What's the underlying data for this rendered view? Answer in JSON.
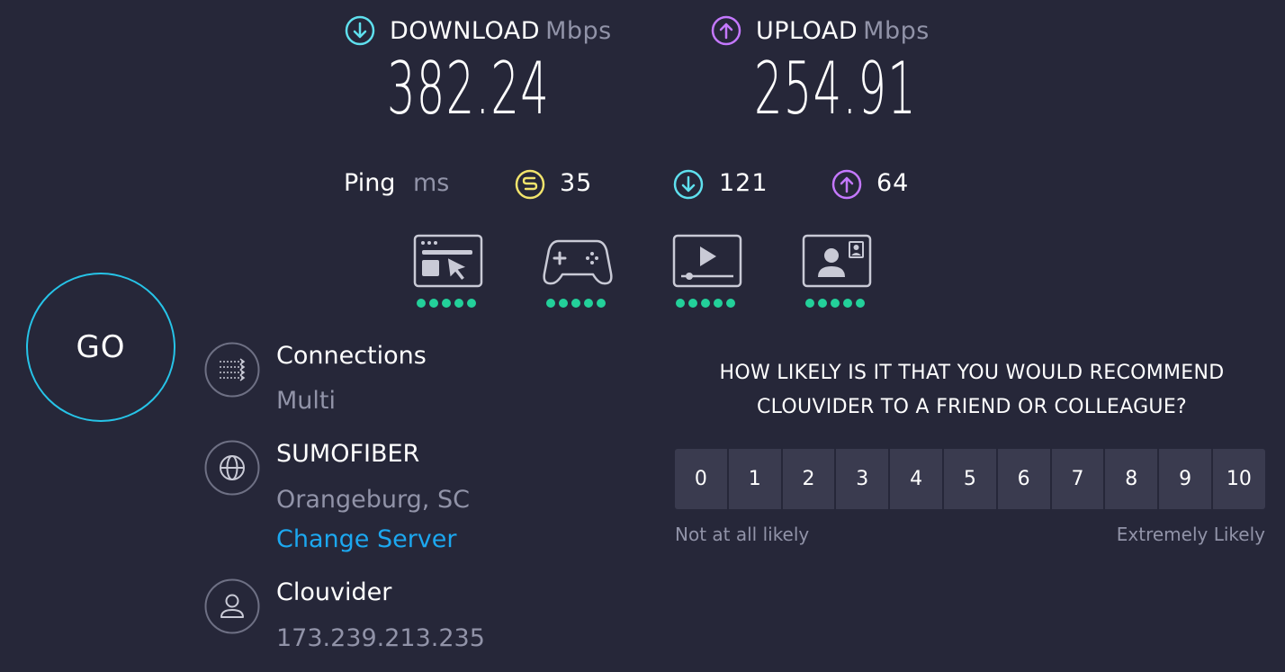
{
  "download": {
    "label": "DOWNLOAD",
    "unit": "Mbps",
    "value": "382.24",
    "icon": "download-arrow-icon",
    "color": "#5fe0ee"
  },
  "upload": {
    "label": "UPLOAD",
    "unit": "Mbps",
    "value": "254.91",
    "icon": "upload-arrow-icon",
    "color": "#c478ff"
  },
  "ping": {
    "label": "Ping",
    "unit": "ms",
    "idle": {
      "value": "35",
      "icon": "ping-idle-icon",
      "color": "#f2e46c"
    },
    "download": {
      "value": "121",
      "icon": "download-arrow-icon",
      "color": "#5fe0ee"
    },
    "upload": {
      "value": "64",
      "icon": "upload-arrow-icon",
      "color": "#c478ff"
    }
  },
  "services": [
    {
      "name": "browsing",
      "icon": "web-browsing-icon",
      "rating": 5,
      "max": 5
    },
    {
      "name": "gaming",
      "icon": "gamepad-icon",
      "rating": 5,
      "max": 5
    },
    {
      "name": "streaming",
      "icon": "video-player-icon",
      "rating": 5,
      "max": 5
    },
    {
      "name": "video-chat",
      "icon": "video-call-icon",
      "rating": 5,
      "max": 5
    }
  ],
  "go_button": {
    "label": "GO",
    "color": "#26c4e8"
  },
  "connections": {
    "title": "Connections",
    "value": "Multi",
    "icon": "connections-icon"
  },
  "server": {
    "title": "SUMOFIBER",
    "location": "Orangeburg, SC",
    "change_label": "Change Server",
    "icon": "globe-icon",
    "link_color": "#1ca8f0"
  },
  "provider": {
    "title": "Clouvider",
    "ip": "173.239.213.235",
    "icon": "user-icon"
  },
  "survey": {
    "question_line1": "HOW LIKELY IS IT THAT YOU WOULD RECOMMEND",
    "question_line2": "CLOUVIDER TO A FRIEND OR COLLEAGUE?",
    "options": [
      "0",
      "1",
      "2",
      "3",
      "4",
      "5",
      "6",
      "7",
      "8",
      "9",
      "10"
    ],
    "low_label": "Not at all likely",
    "high_label": "Extremely Likely"
  },
  "colors": {
    "background": "#262739",
    "muted": "#9193a8",
    "rating_dot": "#23d09a",
    "button_bg": "#3a3b4f"
  }
}
